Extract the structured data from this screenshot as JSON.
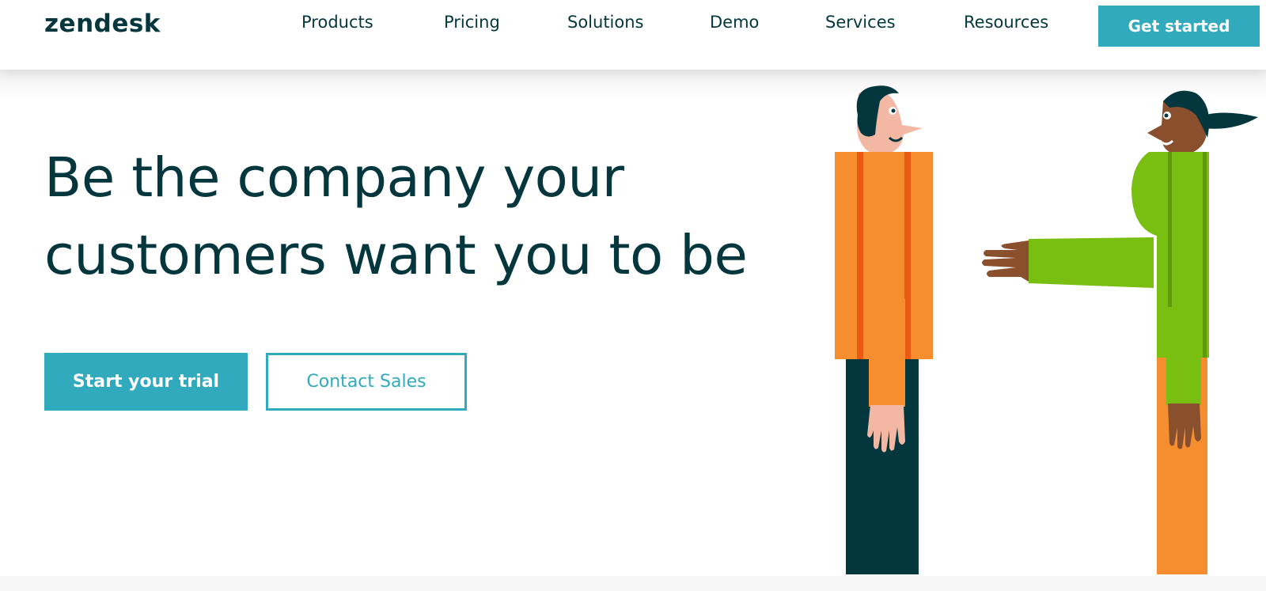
{
  "header": {
    "logo": "zendesk",
    "nav": [
      "Products",
      "Pricing",
      "Solutions",
      "Demo",
      "Services",
      "Resources"
    ],
    "cta_label": "Get started"
  },
  "hero": {
    "headline": "Be the company your customers want you to be",
    "primary_cta": "Start your trial",
    "secondary_cta": "Contact Sales"
  },
  "colors": {
    "brand_teal": "#30aabc",
    "dark_text": "#03363d",
    "orange": "#f68d2e",
    "green": "#78bf11"
  },
  "icons": [
    "illustration-person-left",
    "illustration-person-right"
  ]
}
